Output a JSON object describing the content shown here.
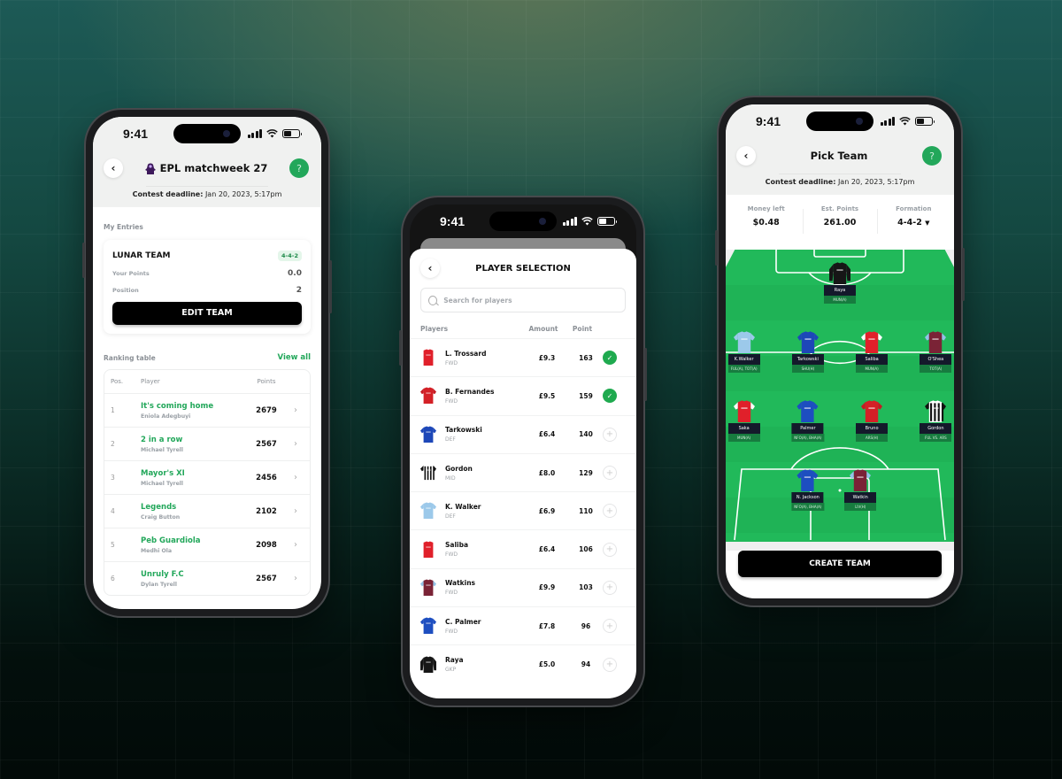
{
  "status_bar": {
    "time": "9:41"
  },
  "colors": {
    "accent_green": "#22a75a",
    "pitch_green": "#21b95a",
    "button_black": "#000000",
    "tag_navy": "#14192b"
  },
  "phone1": {
    "nav": {
      "title": "EPL matchweek 27",
      "back_icon": "chevron-left-icon",
      "help_label": "?"
    },
    "deadline": {
      "label": "Contest deadline:",
      "value": "Jan 20, 2023, 5:17pm"
    },
    "my_entries_label": "My Entries",
    "entry": {
      "team_name": "LUNAR TEAM",
      "formation": "4-4-2",
      "points_label": "Your Points",
      "points_value": "0.0",
      "position_label": "Position",
      "position_value": "2",
      "edit_button": "EDIT TEAM"
    },
    "ranking": {
      "title": "Ranking table",
      "view_all": "View all",
      "columns": [
        "Pos.",
        "Player",
        "Points"
      ],
      "rows": [
        {
          "pos": "1",
          "team": "It's coming home",
          "manager": "Eniola Adegbuyi",
          "points": "2679"
        },
        {
          "pos": "2",
          "team": "2 in a row",
          "manager": "Michael Tyrell",
          "points": "2567"
        },
        {
          "pos": "3",
          "team": "Mayor's XI",
          "manager": "Michael Tyrell",
          "points": "2456"
        },
        {
          "pos": "4",
          "team": "Legends",
          "manager": "Craig Button",
          "points": "2102"
        },
        {
          "pos": "5",
          "team": "Peb Guardiola",
          "manager": "Medhi Ola",
          "points": "2098"
        },
        {
          "pos": "6",
          "team": "Unruly F.C",
          "manager": "Dylan Tyrell",
          "points": "2567"
        }
      ]
    }
  },
  "phone2": {
    "title": "PLAYER SELECTION",
    "search_placeholder": "Search for players",
    "columns": [
      "Players",
      "Amount",
      "Point"
    ],
    "players": [
      {
        "name": "L. Trossard",
        "position": "FWD",
        "amount": "£9.3",
        "points": "163",
        "selected": true,
        "kit": "arsenal"
      },
      {
        "name": "B. Fernandes",
        "position": "FWD",
        "amount": "£9.5",
        "points": "159",
        "selected": true,
        "kit": "manutd"
      },
      {
        "name": "Tarkowski",
        "position": "DEF",
        "amount": "£6.4",
        "points": "140",
        "selected": false,
        "kit": "everton"
      },
      {
        "name": "Gordon",
        "position": "MID",
        "amount": "£8.0",
        "points": "129",
        "selected": false,
        "kit": "newcastle"
      },
      {
        "name": "K. Walker",
        "position": "DEF",
        "amount": "£6.9",
        "points": "110",
        "selected": false,
        "kit": "mancity"
      },
      {
        "name": "Saliba",
        "position": "FWD",
        "amount": "£6.4",
        "points": "106",
        "selected": false,
        "kit": "arsenal"
      },
      {
        "name": "Watkins",
        "position": "FWD",
        "amount": "£9.9",
        "points": "103",
        "selected": false,
        "kit": "villa"
      },
      {
        "name": "C. Palmer",
        "position": "FWD",
        "amount": "£7.8",
        "points": "96",
        "selected": false,
        "kit": "chelsea"
      },
      {
        "name": "Raya",
        "position": "GKP",
        "amount": "£5.0",
        "points": "94",
        "selected": false,
        "kit": "gk"
      }
    ]
  },
  "phone3": {
    "nav": {
      "title": "Pick Team",
      "help_label": "?"
    },
    "deadline": {
      "label": "Contest deadline:",
      "value": "Jan 20, 2023, 5:17pm"
    },
    "stats": [
      {
        "label": "Money left",
        "value": "$0.48"
      },
      {
        "label": "Est. Points",
        "value": "261.00"
      },
      {
        "label": "Formation",
        "value": "4-4-2"
      }
    ],
    "lineup": [
      {
        "name": "Raya",
        "fixture": "MUN(A)",
        "kit": "gk",
        "row": 0,
        "col": 0.5
      },
      {
        "name": "K.Walker",
        "fixture": "FUL(A), TOT(A)",
        "kit": "mancity",
        "row": 1,
        "col": 0.08
      },
      {
        "name": "Tarkowski",
        "fixture": "SHU(H)",
        "kit": "everton",
        "row": 1,
        "col": 0.36
      },
      {
        "name": "Saliba",
        "fixture": "MUN(A)",
        "kit": "arsenal",
        "row": 1,
        "col": 0.64
      },
      {
        "name": "O'Shea",
        "fixture": "TOT(A)",
        "kit": "burnley",
        "row": 1,
        "col": 0.92
      },
      {
        "name": "Saka",
        "fixture": "MUN(A)",
        "kit": "arsenal",
        "row": 2,
        "col": 0.08
      },
      {
        "name": "Palmer",
        "fixture": "NFO(A), BHA(A)",
        "kit": "chelsea",
        "row": 2,
        "col": 0.36
      },
      {
        "name": "Bruno",
        "fixture": "ARS(H)",
        "kit": "manutd",
        "row": 2,
        "col": 0.64
      },
      {
        "name": "Gordon",
        "fixture": "FUL VS. ARS",
        "kit": "newcastle",
        "row": 2,
        "col": 0.92
      },
      {
        "name": "N. Jackson",
        "fixture": "NFO(A), BHA(A)",
        "kit": "chelsea",
        "row": 3,
        "col": 0.36
      },
      {
        "name": "Watkin",
        "fixture": "LIV(H)",
        "kit": "villa",
        "row": 3,
        "col": 0.59
      }
    ],
    "create_button": "CREATE TEAM"
  }
}
